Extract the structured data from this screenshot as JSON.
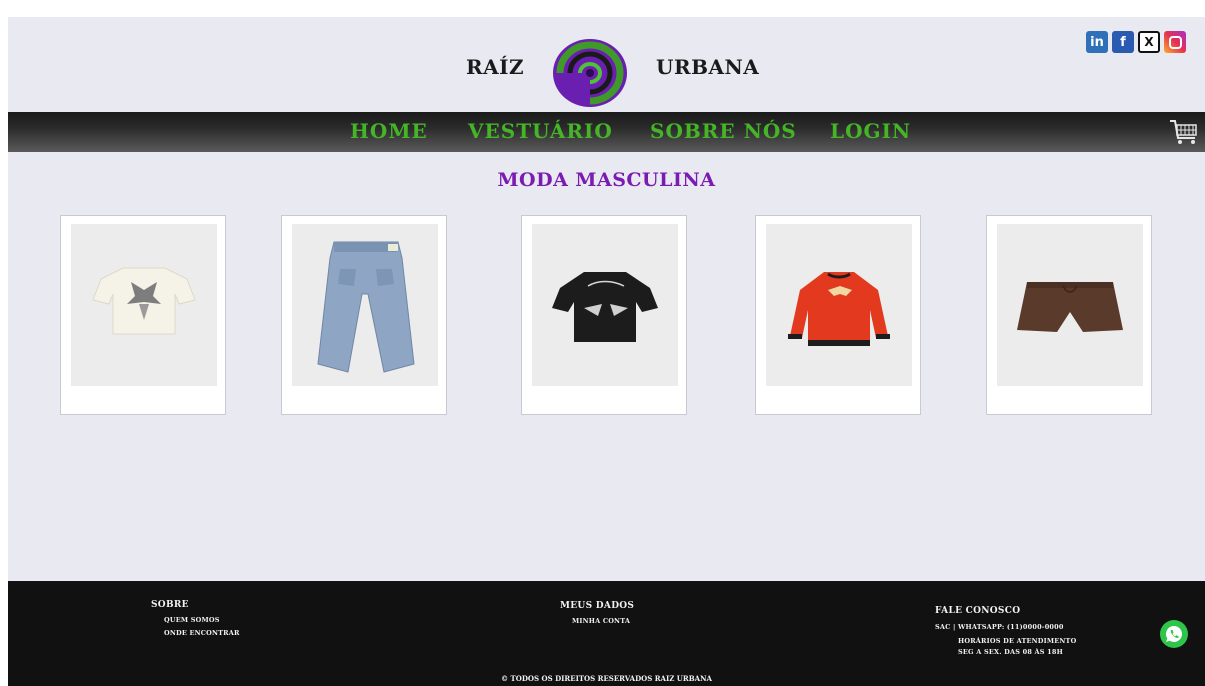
{
  "header": {
    "brand_left": "RAÍZ",
    "brand_right": "URBANA",
    "logo_icon": "spiral-logo",
    "socials": [
      {
        "name": "linkedin-icon",
        "text": "in"
      },
      {
        "name": "facebook-icon",
        "text": "f"
      },
      {
        "name": "x-icon",
        "text": "X"
      },
      {
        "name": "instagram-icon",
        "text": ""
      }
    ]
  },
  "nav": {
    "items": [
      "HOME",
      "VESTUÁRIO",
      "SOBRE NÓS",
      "LOGIN"
    ],
    "cart_icon": "cart-icon"
  },
  "main": {
    "title": "MODA MASCULINA",
    "products": [
      {
        "name": "white-graphic-tee"
      },
      {
        "name": "baggy-jeans"
      },
      {
        "name": "black-graphic-tee"
      },
      {
        "name": "red-bomber-jacket"
      },
      {
        "name": "brown-shorts"
      }
    ]
  },
  "footer": {
    "col1": {
      "title": "SOBRE",
      "items": [
        "QUEM SOMOS",
        "ONDE ENCONTRAR"
      ]
    },
    "col2": {
      "title": "MEUS DADOS",
      "items": [
        "MINHA CONTA"
      ]
    },
    "col3": {
      "title": "FALE CONOSCO",
      "lines": [
        "SAC | WHATSAPP: (11)0000-0000",
        "HORÁRIOS DE ATENDIMENTO",
        "SEG A SEX. DAS 08 ÀS 18H"
      ]
    },
    "copyright": "© TODOS OS DIREITOS RESERVADOS RAIZ URBANA",
    "whatsapp_icon": "whatsapp-icon"
  },
  "colors": {
    "accent_purple": "#7a1cb2",
    "nav_green": "#45b527",
    "background": "#e9e9f1",
    "footer": "#111111"
  }
}
